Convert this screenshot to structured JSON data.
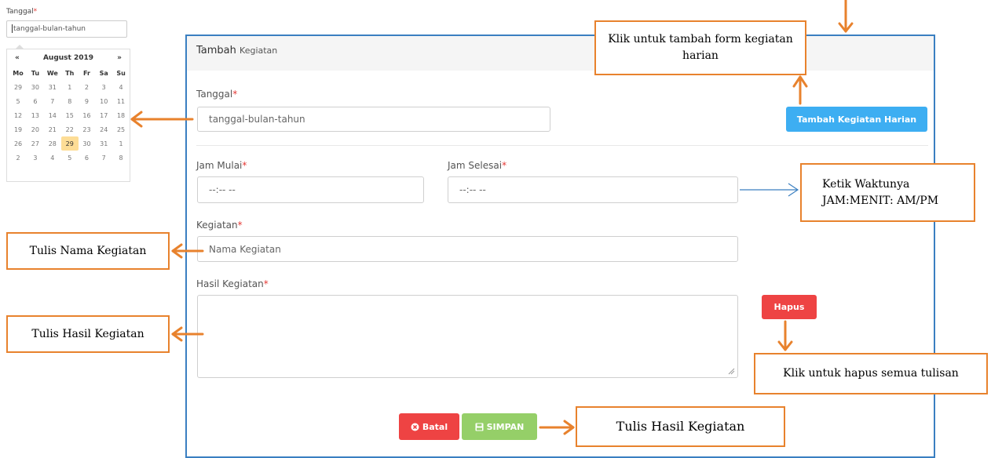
{
  "datepicker": {
    "label": "Tanggal",
    "required_mark": "*",
    "input_placeholder": "tanggal-bulan-tahun",
    "prev": "«",
    "next": "»",
    "month_year": "August 2019",
    "weekdays": [
      "Mo",
      "Tu",
      "We",
      "Th",
      "Fr",
      "Sa",
      "Su"
    ],
    "weeks": [
      [
        "29",
        "30",
        "31",
        "1",
        "2",
        "3",
        "4"
      ],
      [
        "5",
        "6",
        "7",
        "8",
        "9",
        "10",
        "11"
      ],
      [
        "12",
        "13",
        "14",
        "15",
        "16",
        "17",
        "18"
      ],
      [
        "19",
        "20",
        "21",
        "22",
        "23",
        "24",
        "25"
      ],
      [
        "26",
        "27",
        "28",
        "29",
        "30",
        "31",
        "1"
      ],
      [
        "2",
        "3",
        "4",
        "5",
        "6",
        "7",
        "8"
      ]
    ],
    "selected_day": "29"
  },
  "panel": {
    "title_main": "Tambah",
    "title_sub": "Kegiatan"
  },
  "form": {
    "tanggal_label": "Tanggal",
    "tanggal_placeholder": "tanggal-bulan-tahun",
    "jam_mulai_label": "Jam Mulai",
    "jam_mulai_placeholder": "--:-- --",
    "jam_selesai_label": "Jam Selesai",
    "jam_selesai_placeholder": "--:-- --",
    "kegiatan_label": "Kegiatan",
    "kegiatan_placeholder": "Nama Kegiatan",
    "hasil_label": "Hasil Kegiatan",
    "required_mark": "*"
  },
  "buttons": {
    "tambah": "Tambah Kegiatan Harian",
    "hapus": "Hapus",
    "batal": "Batal",
    "simpan": "SIMPAN"
  },
  "annotations": {
    "tambah_form": "Klik untuk tambah form kegiatan harian",
    "ketik_waktu_line1": "Ketik Waktunya",
    "ketik_waktu_line2": "JAM:MENIT: AM/PM",
    "tulis_nama": "Tulis Nama Kegiatan",
    "tulis_hasil": "Tulis Hasil Kegiatan",
    "hapus_semua": "Klik untuk hapus semua tulisan",
    "tulis_hasil_bottom": "Tulis Hasil Kegiatan"
  },
  "colors": {
    "panel_border": "#3a7fc1",
    "annotation_orange": "#e8822d",
    "btn_blue": "#3daef2",
    "btn_red": "#ee4343",
    "btn_green": "#95cf68",
    "required": "#e53935"
  }
}
